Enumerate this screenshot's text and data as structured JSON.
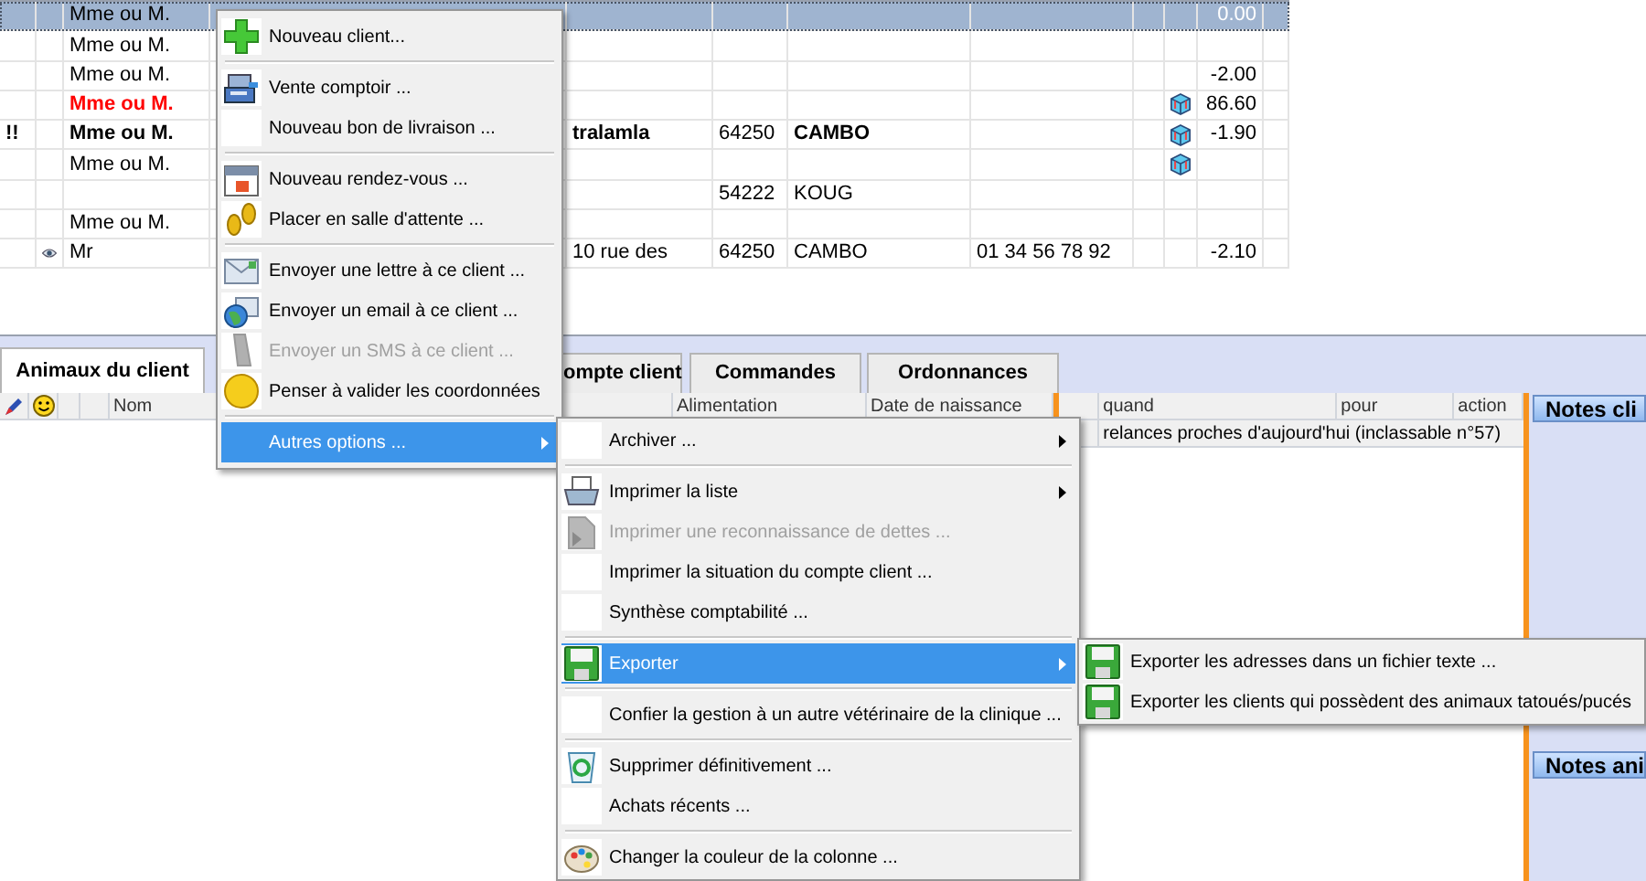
{
  "client_table": {
    "rows": [
      {
        "title": "Mme ou M.",
        "amount": "0.00",
        "selected": true
      },
      {
        "title": "Mme ou M.",
        "selected": false
      },
      {
        "title": "Mme ou M.",
        "amount": "-2.00",
        "selected": false
      },
      {
        "title": "Mme ou M.",
        "box_icon": true,
        "amount": "86.60",
        "selected": false,
        "red": true,
        "bold": true
      },
      {
        "flag": "!!",
        "title": "Mme ou M.",
        "address": "tralamla",
        "postcode": "64250",
        "city": "CAMBO",
        "box_icon": true,
        "amount": "-1.90",
        "selected": false,
        "bold": true
      },
      {
        "title": "Mme ou M.",
        "box_icon": true,
        "selected": false
      },
      {
        "postcode": "54222",
        "city": "KOUG",
        "selected": false
      },
      {
        "title": "Mme ou M.",
        "selected": false
      },
      {
        "eye_icon": true,
        "title": "Mr",
        "address": "10 rue des",
        "postcode": "64250",
        "city": "CAMBO",
        "phone": "01 34 56 78 92",
        "amount": "-2.10",
        "selected": false
      }
    ]
  },
  "tabs": [
    {
      "label": "Animaux du client",
      "selected": true
    },
    {
      "label": "ompte client",
      "selected": false
    },
    {
      "label": "Commandes",
      "selected": false
    },
    {
      "label": "Ordonnances",
      "selected": false
    }
  ],
  "animals_grid": {
    "columns": [
      "Nom",
      "Alimentation",
      "Date de naissance"
    ]
  },
  "reminders_grid": {
    "columns": [
      "quand",
      "pour",
      "action"
    ],
    "rows": [
      "relances proches d'aujourd'hui (inclassable n°57)"
    ]
  },
  "notes_panels": [
    "Notes cli",
    "Notes ani"
  ],
  "context_menu": {
    "items": [
      {
        "label": "Nouveau client...",
        "kind": "plus",
        "disabled": false,
        "selected": false
      },
      {
        "label": "Vente comptoir ...",
        "kind": "register",
        "disabled": false,
        "selected": false,
        "separator_before": true
      },
      {
        "label": "Nouveau bon de livraison ...",
        "kind": "blank",
        "disabled": false,
        "selected": false
      },
      {
        "label": "Nouveau rendez-vous ...",
        "kind": "calendar",
        "disabled": false,
        "selected": false,
        "separator_before": true
      },
      {
        "label": "Placer en salle d'attente ...",
        "kind": "footprints",
        "disabled": false,
        "selected": false
      },
      {
        "label": "Envoyer une lettre à ce client ...",
        "kind": "letter",
        "disabled": false,
        "selected": false,
        "separator_before": true
      },
      {
        "label": "Envoyer un email à ce client ...",
        "kind": "email",
        "disabled": false,
        "selected": false
      },
      {
        "label": "Envoyer un SMS à ce client ...",
        "kind": "phone",
        "disabled": true,
        "selected": false
      },
      {
        "label": "Penser à valider les coordonnées",
        "kind": "coin",
        "disabled": false,
        "selected": false
      },
      {
        "label": "Autres options ...",
        "kind": "none",
        "disabled": false,
        "selected": true,
        "separator_before": true,
        "has_submenu": true
      }
    ]
  },
  "options_submenu": {
    "items": [
      {
        "label": "Archiver ...",
        "kind": "blank",
        "disabled": false,
        "selected": false,
        "has_submenu": true
      },
      {
        "label": "Imprimer la liste",
        "kind": "printer",
        "disabled": false,
        "selected": false,
        "separator_before": true,
        "has_submenu": true
      },
      {
        "label": "Imprimer une reconnaissance de dettes ...",
        "kind": "document",
        "disabled": true,
        "selected": false
      },
      {
        "label": "Imprimer la situation du compte client ...",
        "kind": "blank",
        "disabled": false,
        "selected": false
      },
      {
        "label": "Synthèse comptabilité ...",
        "kind": "blank",
        "disabled": false,
        "selected": false
      },
      {
        "label": "Exporter",
        "kind": "floppy",
        "disabled": false,
        "selected": true,
        "separator_before": true,
        "has_submenu": true
      },
      {
        "label": "Confier la gestion à un autre vétérinaire de la clinique ...",
        "kind": "blank",
        "disabled": false,
        "selected": false,
        "separator_before": true
      },
      {
        "label": "Supprimer définitivement ...",
        "kind": "recycle",
        "disabled": false,
        "selected": false,
        "separator_before": true
      },
      {
        "label": "Achats récents ...",
        "kind": "blank",
        "disabled": false,
        "selected": false
      },
      {
        "label": "Changer la couleur de la colonne ...",
        "kind": "palette",
        "disabled": false,
        "selected": false,
        "separator_before": true
      }
    ]
  },
  "export_submenu": {
    "items": [
      {
        "label": "Exporter les adresses dans un fichier texte ...",
        "kind": "floppy",
        "disabled": false,
        "selected": false
      },
      {
        "label": "Exporter les clients qui possèdent des animaux tatoués/pucés",
        "kind": "floppy",
        "disabled": false,
        "selected": false
      }
    ]
  }
}
